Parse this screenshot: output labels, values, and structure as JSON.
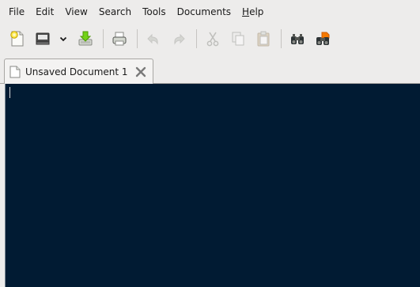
{
  "menubar": {
    "items": [
      {
        "label": "File"
      },
      {
        "label": "Edit"
      },
      {
        "label": "View"
      },
      {
        "label": "Search"
      },
      {
        "label": "Tools"
      },
      {
        "label": "Documents"
      },
      {
        "label_mnemonic": "H",
        "label_rest": "elp"
      }
    ]
  },
  "toolbar": {
    "buttons": [
      {
        "icon": "new-document-icon"
      },
      {
        "icon": "open-icon"
      },
      {
        "icon": "chevron-down-icon"
      },
      {
        "icon": "save-icon"
      },
      {
        "icon": "print-icon"
      },
      {
        "icon": "undo-icon"
      },
      {
        "icon": "redo-icon"
      },
      {
        "icon": "cut-icon"
      },
      {
        "icon": "copy-icon"
      },
      {
        "icon": "paste-icon"
      },
      {
        "icon": "find-icon"
      },
      {
        "icon": "find-replace-icon"
      }
    ]
  },
  "tabs": [
    {
      "label": "Unsaved Document 1"
    }
  ],
  "editor": {
    "text": "",
    "background": "#011b33"
  }
}
